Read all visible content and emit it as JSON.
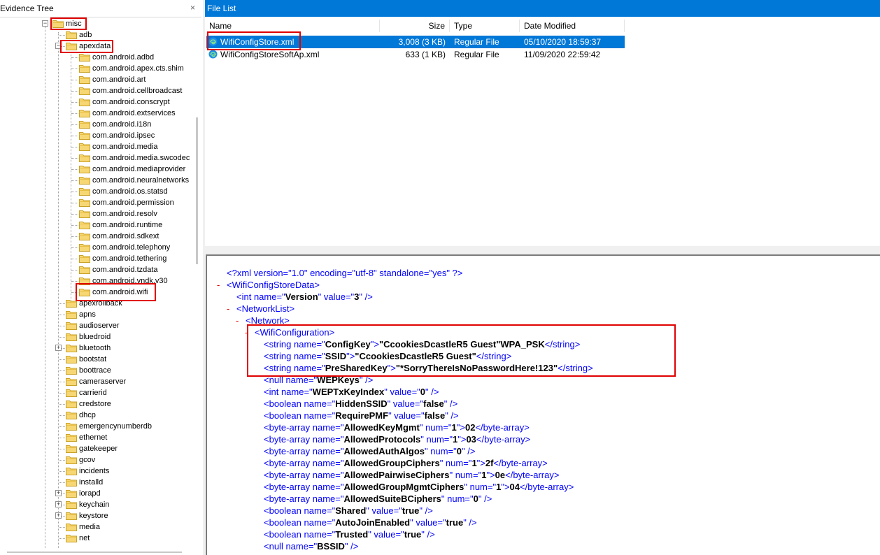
{
  "tree": {
    "title": "Evidence Tree",
    "close_glyph": "×",
    "top_folder": "misc",
    "items": [
      "adb",
      "apexdata",
      "com.android.adbd",
      "com.android.apex.cts.shim",
      "com.android.art",
      "com.android.cellbroadcast",
      "com.android.conscrypt",
      "com.android.extservices",
      "com.android.i18n",
      "com.android.ipsec",
      "com.android.media",
      "com.android.media.swcodec",
      "com.android.mediaprovider",
      "com.android.neuralnetworks",
      "com.android.os.statsd",
      "com.android.permission",
      "com.android.resolv",
      "com.android.runtime",
      "com.android.sdkext",
      "com.android.telephony",
      "com.android.tethering",
      "com.android.tzdata",
      "com.android.vndk.v30",
      "com.android.wifi",
      "apexrollback",
      "apns",
      "audioserver",
      "bluedroid",
      "bluetooth",
      "bootstat",
      "boottrace",
      "cameraserver",
      "carrierid",
      "credstore",
      "dhcp",
      "emergencynumberdb",
      "ethernet",
      "gatekeeper",
      "gcov",
      "incidents",
      "installd",
      "iorapd",
      "keychain",
      "keystore",
      "media",
      "net"
    ]
  },
  "filelist": {
    "title": "File List",
    "columns": {
      "name": "Name",
      "size": "Size",
      "type": "Type",
      "date": "Date Modified"
    },
    "rows": [
      {
        "name": "WifiConfigStore.xml",
        "size": "3,008 (3 KB)",
        "type": "Regular File",
        "date": "05/10/2020 18:59:37"
      },
      {
        "name": "WifiConfigStoreSoftAp.xml",
        "size": "633 (1 KB)",
        "type": "Regular File",
        "date": "11/09/2020 22:59:42"
      }
    ]
  },
  "xml": {
    "declaration": "<?xml version=\"1.0\" encoding=\"utf-8\" standalone=\"yes\" ?>",
    "toggle": "-",
    "root_tag": "WifiConfigStoreData",
    "version": {
      "type": "int",
      "name": "Version",
      "value": "3"
    },
    "network_list_tag": "NetworkList",
    "network_tag": "Network",
    "wifi_config_tag": "WifiConfiguration",
    "strings": [
      {
        "name": "ConfigKey",
        "text": "\"CcookiesDcastleR5 Guest\"WPA_PSK"
      },
      {
        "name": "SSID",
        "text": "\"CcookiesDcastleR5 Guest\""
      },
      {
        "name": "PreSharedKey",
        "text": "\"*SorryThereIsNoPasswordHere!123\""
      }
    ],
    "wep_keys": {
      "name": "WEPKeys"
    },
    "wep_index": {
      "name": "WEPTxKeyIndex",
      "value": "0"
    },
    "booleans_a": [
      {
        "name": "HiddenSSID",
        "value": "false"
      },
      {
        "name": "RequirePMF",
        "value": "false"
      }
    ],
    "byte_arrays": [
      {
        "name": "AllowedKeyMgmt",
        "num": "1",
        "text": "02"
      },
      {
        "name": "AllowedProtocols",
        "num": "1",
        "text": "03"
      },
      {
        "name": "AllowedAuthAlgos",
        "num": "0",
        "text": ""
      },
      {
        "name": "AllowedGroupCiphers",
        "num": "1",
        "text": "2f"
      },
      {
        "name": "AllowedPairwiseCiphers",
        "num": "1",
        "text": "0e"
      },
      {
        "name": "AllowedGroupMgmtCiphers",
        "num": "1",
        "text": "04"
      },
      {
        "name": "AllowedSuiteBCiphers",
        "num": "0",
        "text": ""
      }
    ],
    "booleans_b": [
      {
        "name": "Shared",
        "value": "true"
      },
      {
        "name": "AutoJoinEnabled",
        "value": "true"
      },
      {
        "name": "Trusted",
        "value": "true"
      }
    ],
    "bssid": {
      "name": "BSSID"
    }
  },
  "colors": {
    "accent": "#0078d7",
    "highlight": "#e00000",
    "xml_markup": "#0000ff",
    "folder": "#f7d774"
  }
}
